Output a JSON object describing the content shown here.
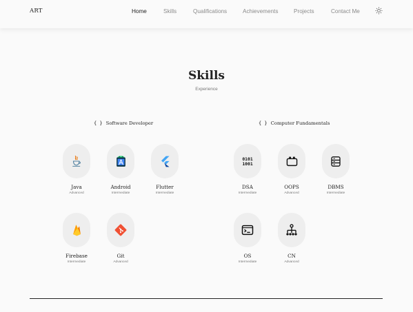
{
  "nav": {
    "brand": "ART",
    "links": [
      "Home",
      "Skills",
      "Qualifications",
      "Achievements",
      "Projects",
      "Contact Me"
    ],
    "active": "Home",
    "theme_icon": "sun-icon"
  },
  "section": {
    "title": "Skills",
    "subtitle": "Experience"
  },
  "groups": [
    {
      "title": "Software Developer",
      "icon": "code-braces-icon",
      "skills": [
        {
          "name": "Java",
          "level": "Advanced",
          "icon": "java-icon"
        },
        {
          "name": "Android",
          "level": "Intermediate",
          "icon": "android-studio-icon"
        },
        {
          "name": "Flutter",
          "level": "Intermediate",
          "icon": "flutter-icon"
        },
        {
          "name": "Firebase",
          "level": "Intermediate",
          "icon": "firebase-icon"
        },
        {
          "name": "Git",
          "level": "Advanced",
          "icon": "git-icon"
        }
      ]
    },
    {
      "title": "Computer Fundamentals",
      "icon": "code-braces-icon",
      "skills": [
        {
          "name": "DSA",
          "level": "Intermediate",
          "icon": "binary-icon"
        },
        {
          "name": "OOPS",
          "level": "Advanced",
          "icon": "object-box-icon"
        },
        {
          "name": "DBMS",
          "level": "Intermediate",
          "icon": "database-server-icon"
        },
        {
          "name": "OS",
          "level": "Intermediate",
          "icon": "terminal-icon"
        },
        {
          "name": "CN",
          "level": "Advanced",
          "icon": "network-tree-icon"
        }
      ]
    }
  ],
  "colors": {
    "background": "#fafafa",
    "circle": "#eeeeee",
    "text": "#222222",
    "muted": "#8a8a8a"
  }
}
